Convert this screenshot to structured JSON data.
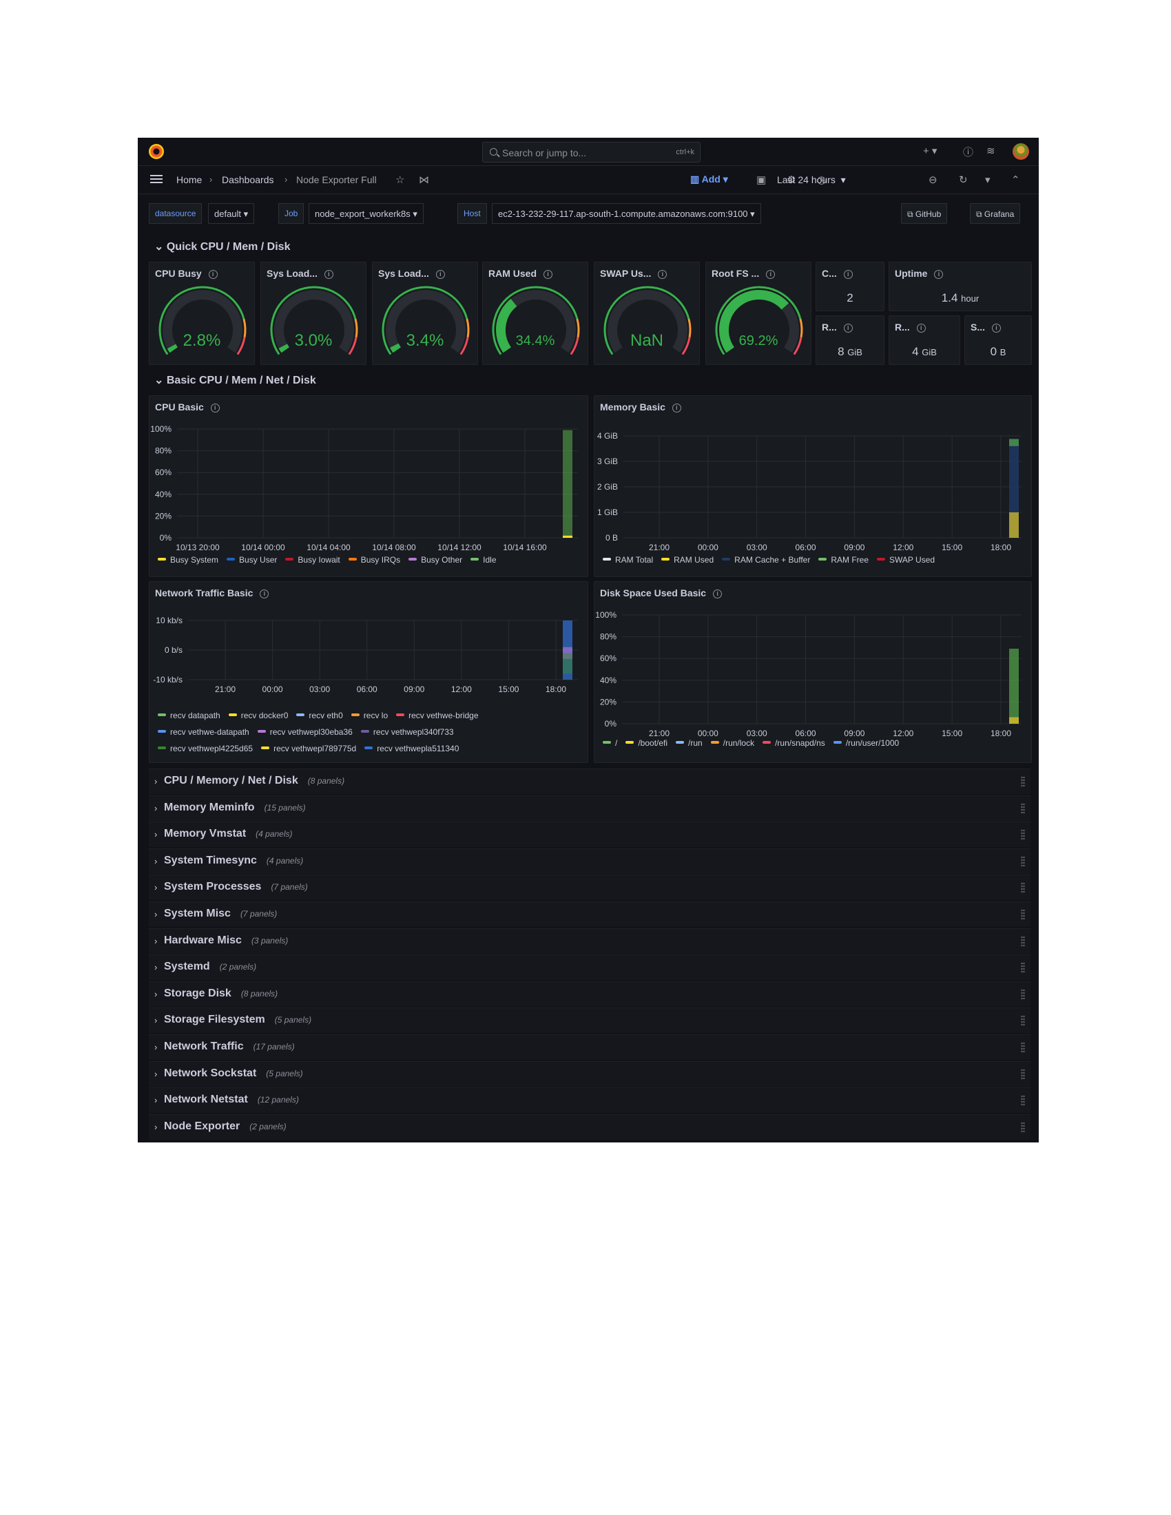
{
  "topbar": {
    "search_placeholder": "Search or jump to...",
    "search_shortcut": "ctrl+k"
  },
  "breadcrumb": [
    "Home",
    "Dashboards",
    "Node Exporter Full"
  ],
  "toolbar": {
    "add_label": "Add",
    "time_range": "Last 24 hours"
  },
  "variables": [
    {
      "label": "datasource",
      "value": "default"
    },
    {
      "label": "Job",
      "value": "node_export_workerk8s"
    },
    {
      "label": "Host",
      "value": "ec2-13-232-29-117.ap-south-1.compute.amazonaws.com:9100"
    }
  ],
  "links": [
    "GitHub",
    "Grafana"
  ],
  "row_quick": "Quick CPU / Mem / Disk",
  "row_basic": "Basic CPU / Mem / Net / Disk",
  "gauges": [
    {
      "title": "CPU Busy",
      "value": "2.8%",
      "fraction": 0.028
    },
    {
      "title": "Sys Load...",
      "value": "3.0%",
      "fraction": 0.03
    },
    {
      "title": "Sys Load...",
      "value": "3.4%",
      "fraction": 0.034
    },
    {
      "title": "RAM Used",
      "value": "34.4%",
      "fraction": 0.344
    },
    {
      "title": "SWAP Us...",
      "value": "NaN",
      "fraction": 0
    },
    {
      "title": "Root FS ...",
      "value": "69.2%",
      "fraction": 0.692
    }
  ],
  "stats": {
    "cores": {
      "title": "C...",
      "value": "2"
    },
    "uptime": {
      "title": "Uptime",
      "value": "1.4",
      "unit": "hour"
    },
    "ram_total": {
      "title": "R...",
      "value": "8",
      "unit": "GiB"
    },
    "swap_total": {
      "title": "R...",
      "value": "4",
      "unit": "GiB"
    },
    "rootfs_total": {
      "title": "S...",
      "value": "0",
      "unit": "B"
    }
  },
  "charts": {
    "cpu": {
      "title": "CPU Basic",
      "yticks": [
        "100%",
        "80%",
        "60%",
        "40%",
        "20%",
        "0%"
      ],
      "xticks": [
        "10/13 20:00",
        "10/14 00:00",
        "10/14 04:00",
        "10/14 08:00",
        "10/14 12:00",
        "10/14 16:00"
      ],
      "legend": [
        {
          "name": "Busy System",
          "color": "#fade2a"
        },
        {
          "name": "Busy User",
          "color": "#1f60c4"
        },
        {
          "name": "Busy Iowait",
          "color": "#c4162a"
        },
        {
          "name": "Busy IRQs",
          "color": "#ff780a"
        },
        {
          "name": "Busy Other",
          "color": "#b877d9"
        },
        {
          "name": "Idle",
          "color": "#73bf69"
        }
      ]
    },
    "memory": {
      "title": "Memory Basic",
      "yticks": [
        "4 GiB",
        "3 GiB",
        "2 GiB",
        "1 GiB",
        "0 B"
      ],
      "xticks": [
        "21:00",
        "00:00",
        "03:00",
        "06:00",
        "09:00",
        "12:00",
        "15:00",
        "18:00"
      ],
      "legend": [
        {
          "name": "RAM Total",
          "color": "#e6e6e6"
        },
        {
          "name": "RAM Used",
          "color": "#fade2a"
        },
        {
          "name": "RAM Cache + Buffer",
          "color": "#1f3a68"
        },
        {
          "name": "RAM Free",
          "color": "#73bf69"
        },
        {
          "name": "SWAP Used",
          "color": "#c4162a"
        }
      ]
    },
    "network": {
      "title": "Network Traffic Basic",
      "yticks": [
        "10 kb/s",
        "0 b/s",
        "-10 kb/s"
      ],
      "xticks": [
        "21:00",
        "00:00",
        "03:00",
        "06:00",
        "09:00",
        "12:00",
        "15:00",
        "18:00"
      ],
      "legend": [
        {
          "name": "recv datapath",
          "color": "#73bf69"
        },
        {
          "name": "recv docker0",
          "color": "#fade2a"
        },
        {
          "name": "recv eth0",
          "color": "#8ab8ff"
        },
        {
          "name": "recv lo",
          "color": "#ff9830"
        },
        {
          "name": "recv vethwe-bridge",
          "color": "#f2495c"
        },
        {
          "name": "recv vethwe-datapath",
          "color": "#5794f2"
        },
        {
          "name": "recv vethwepl30eba36",
          "color": "#b877d9"
        },
        {
          "name": "recv vethwepl340f733",
          "color": "#705da0"
        },
        {
          "name": "recv vethwepl4225d65",
          "color": "#37872d"
        },
        {
          "name": "recv vethwepl789775d",
          "color": "#fade2a"
        },
        {
          "name": "recv vethwepla511340",
          "color": "#3274d9"
        }
      ]
    },
    "disk": {
      "title": "Disk Space Used Basic",
      "yticks": [
        "100%",
        "80%",
        "60%",
        "40%",
        "20%",
        "0%"
      ],
      "xticks": [
        "21:00",
        "00:00",
        "03:00",
        "06:00",
        "09:00",
        "12:00",
        "15:00",
        "18:00"
      ],
      "legend": [
        {
          "name": "/",
          "color": "#73bf69"
        },
        {
          "name": "/boot/efi",
          "color": "#fade2a"
        },
        {
          "name": "/run",
          "color": "#8ab8ff"
        },
        {
          "name": "/run/lock",
          "color": "#ff9830"
        },
        {
          "name": "/run/snapd/ns",
          "color": "#f2495c"
        },
        {
          "name": "/run/user/1000",
          "color": "#5794f2"
        }
      ]
    }
  },
  "collapsed_rows": [
    {
      "name": "CPU / Memory / Net / Disk",
      "count": "(8 panels)"
    },
    {
      "name": "Memory Meminfo",
      "count": "(15 panels)"
    },
    {
      "name": "Memory Vmstat",
      "count": "(4 panels)"
    },
    {
      "name": "System Timesync",
      "count": "(4 panels)"
    },
    {
      "name": "System Processes",
      "count": "(7 panels)"
    },
    {
      "name": "System Misc",
      "count": "(7 panels)"
    },
    {
      "name": "Hardware Misc",
      "count": "(3 panels)"
    },
    {
      "name": "Systemd",
      "count": "(2 panels)"
    },
    {
      "name": "Storage Disk",
      "count": "(8 panels)"
    },
    {
      "name": "Storage Filesystem",
      "count": "(5 panels)"
    },
    {
      "name": "Network Traffic",
      "count": "(17 panels)"
    },
    {
      "name": "Network Sockstat",
      "count": "(5 panels)"
    },
    {
      "name": "Network Netstat",
      "count": "(12 panels)"
    },
    {
      "name": "Node Exporter",
      "count": "(2 panels)"
    }
  ]
}
